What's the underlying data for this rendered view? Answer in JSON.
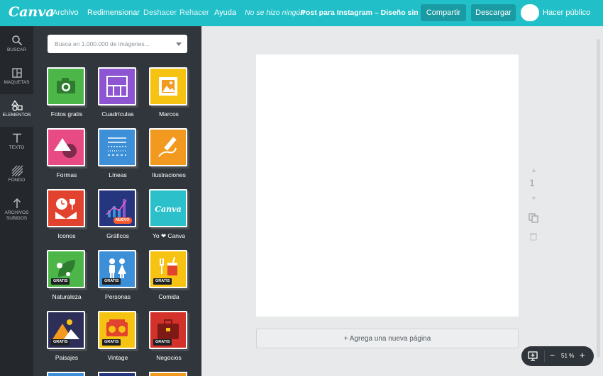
{
  "topbar": {
    "logo": "Canva",
    "menu": [
      "Archivo",
      "Redimensionar"
    ],
    "undo": "Deshacer",
    "redo": "Rehacer",
    "help": "Ayuda",
    "save_status": "No se hizo ningún",
    "doc_title": "Post para Instagram – Diseño sin ...",
    "share_label": "Compartir",
    "download_label": "Descargar",
    "public_label": "Hacer público"
  },
  "rail": [
    {
      "label": "BUSCAR",
      "icon": "search-icon",
      "active": false
    },
    {
      "label": "MAQUETAS",
      "icon": "layout-icon",
      "active": false
    },
    {
      "label": "ELEMENTOS",
      "icon": "shapes-icon",
      "active": true
    },
    {
      "label": "TEXTO",
      "icon": "text-icon",
      "active": false
    },
    {
      "label": "FONDO",
      "icon": "background-icon",
      "active": false
    },
    {
      "label": "ARCHIVOS",
      "label2": "SUBIDOS",
      "icon": "upload-icon",
      "active": false
    }
  ],
  "panel": {
    "search_placeholder": "Busca en 1.000.000 de imágenes...",
    "tiles": [
      {
        "label": "Fotos gratis",
        "icon": "camera-icon",
        "color": "#4cb648"
      },
      {
        "label": "Cuadrículas",
        "icon": "grid-icon",
        "color": "#8e55d3"
      },
      {
        "label": "Marcos",
        "icon": "frame-icon",
        "color": "#f7c313"
      },
      {
        "label": "Formas",
        "icon": "shapes-icon",
        "color": "#e84a83"
      },
      {
        "label": "Líneas",
        "icon": "lines-icon",
        "color": "#3d8fd8"
      },
      {
        "label": "Ilustraciones",
        "icon": "pencil-icon",
        "color": "#f29a1f"
      },
      {
        "label": "Iconos",
        "icon": "clock-icon",
        "color": "#e2432e"
      },
      {
        "label": "Gráficos",
        "icon": "chart-icon",
        "color": "#26367e",
        "badge": "NUEVO"
      },
      {
        "label": "Yo ❤ Canva",
        "icon": "canva-icon",
        "color": "#2bc0ca"
      },
      {
        "label": "Naturaleza",
        "icon": "leaf-icon",
        "color": "#4cb648",
        "badge": "GRATIS"
      },
      {
        "label": "Personas",
        "icon": "people-icon",
        "color": "#3d8fd8",
        "badge": "GRATIS"
      },
      {
        "label": "Comida",
        "icon": "food-icon",
        "color": "#f7c313",
        "badge": "GRATIS"
      },
      {
        "label": "Paisajes",
        "icon": "mountain-icon",
        "color": "#f29a1f",
        "badge": "GRATIS"
      },
      {
        "label": "Vintage",
        "icon": "radio-icon",
        "color": "#f7c313",
        "badge": "GRATIS"
      },
      {
        "label": "Negocios",
        "icon": "briefcase-icon",
        "color": "#d3322b",
        "badge": "GRATIS"
      }
    ]
  },
  "canvas": {
    "page_number": "1",
    "add_page_label": "+ Agrega una nueva página",
    "zoom": "51 %",
    "zoom_minus": "−",
    "zoom_plus": "+"
  },
  "colors": {
    "brand": "#21c0c9",
    "rail_bg": "#24282c",
    "panel_bg": "#31363c",
    "workspace_bg": "#e8e9ea"
  }
}
